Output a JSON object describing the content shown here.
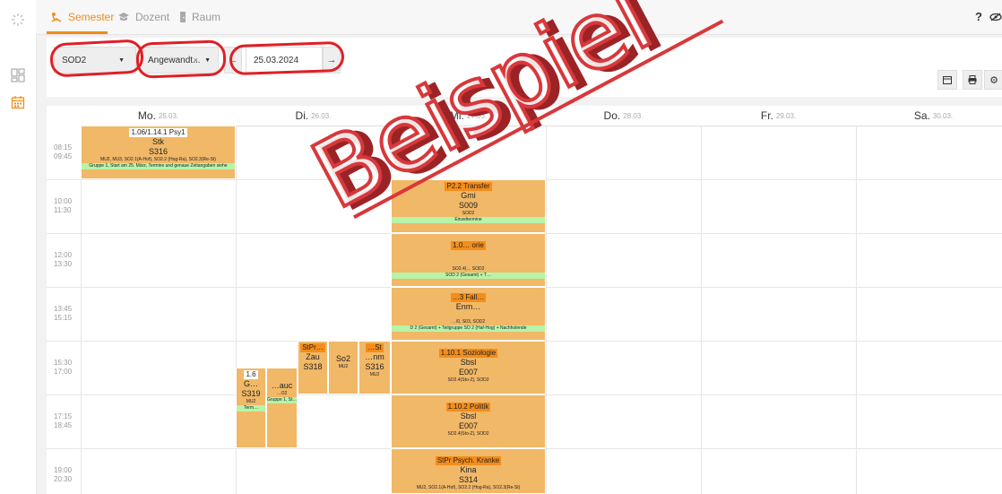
{
  "nav": {
    "tabs": [
      {
        "label": "Semester"
      },
      {
        "label": "Dozent"
      },
      {
        "label": "Raum"
      }
    ],
    "help": "?"
  },
  "filters": {
    "semester": "SOD2",
    "subject": "Angewandt...",
    "date": "25.03.2024"
  },
  "calendar": {
    "days": [
      {
        "name": "Mo.",
        "date": "25.03."
      },
      {
        "name": "Di.",
        "date": "26.03."
      },
      {
        "name": "Mi.",
        "date": "27.03."
      },
      {
        "name": "Do.",
        "date": "28.03."
      },
      {
        "name": "Fr.",
        "date": "29.03."
      },
      {
        "name": "Sa.",
        "date": "30.03."
      }
    ],
    "times": [
      {
        "start": "08:15",
        "end": "09:45"
      },
      {
        "start": "10:00",
        "end": "11:30"
      },
      {
        "start": "12:00",
        "end": "13:30"
      },
      {
        "start": "13:45",
        "end": "15:15"
      },
      {
        "start": "15:30",
        "end": "17:00"
      },
      {
        "start": "17:15",
        "end": "18:45"
      },
      {
        "start": "19:00",
        "end": "20:30"
      }
    ]
  },
  "events": {
    "mo1": {
      "title": "1.06/1.14.1 Psy1",
      "lecturer": "Stk",
      "room": "S316",
      "groups": "MU2, MU3, SO2.1(A-Hof), SO2.2 (Hog-Ra), SO2.3(Re-St)",
      "note": "Gruppe 1, Start am 25. März, Termine und genaue Zeitangaben siehe"
    },
    "mi1": {
      "title": "P2.2 Transfer",
      "lecturer": "Gmi",
      "room": "S009",
      "groups": "SOD2",
      "note": "Einzeltermine"
    },
    "mi2": {
      "title": "1.0… orie",
      "groups": "SO2.4(… SOD2",
      "note": "SOD 2 (Gesamt) + T…"
    },
    "mi3": {
      "title": "…3 Fall…",
      "lecturer": "Enm…",
      "groups": "…/0, S03, SOD2",
      "note": "D 2 (Gesamt) + Teilgruppe SO 2 (Haf-Hog) + Nachholende"
    },
    "mi4": {
      "title": "1.10.1 Soziologie",
      "lecturer": "Sbsl",
      "room": "E007",
      "groups": "SO2.4(Sto-Z), SOD2"
    },
    "mi5": {
      "title": "1.10.2 Politik",
      "lecturer": "Sbsl",
      "room": "E007",
      "groups": "SO2.4(Sto-Z), SOD2"
    },
    "mi6": {
      "title": "StPr Psych. Kranke",
      "lecturer": "Kina",
      "room": "S314",
      "groups": "MU2, SO2.1(A-Hof), SO2.2 (Hog-Ra), SO2.3(Re-St)"
    },
    "di1": {
      "title": "StPr…",
      "lecturer": "Zau",
      "room": "S318"
    },
    "di2": {
      "lecturer": "So2",
      "groups": "MU2"
    },
    "di3": {
      "title": "…St",
      "lecturer": "…nm",
      "room": "S316",
      "groups": "MU2"
    },
    "di4": {
      "title": "1.6",
      "lecturer": "G…",
      "room": "S319",
      "groups": "MU2",
      "note": "Term…"
    },
    "di5": {
      "lecturer": "…auc",
      "groups": "…O2",
      "note": "Gruppe 1, St…"
    }
  },
  "watermark": "Beispiel",
  "colors": {
    "accent": "#f08c1a",
    "event": "#f1b867",
    "title_bg": "#f48d1a",
    "note_bg": "#b7f4a8",
    "watermark": "#d8383b"
  }
}
